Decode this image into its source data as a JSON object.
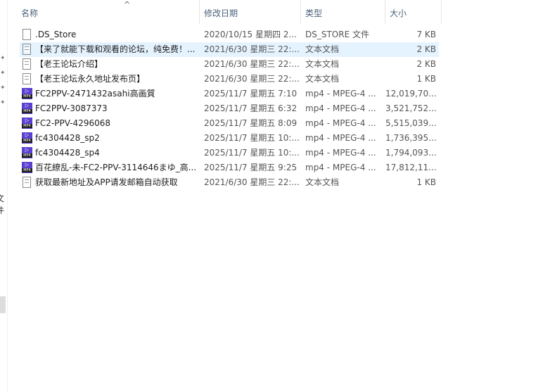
{
  "columns": {
    "name": "名称",
    "date": "修改日期",
    "type": "类型",
    "size": "大小"
  },
  "left_fragment": "文件",
  "files": [
    {
      "icon": "file-icon",
      "name": ".DS_Store",
      "date": "2020/10/15 星期四 2...",
      "type": "DS_STORE 文件",
      "size": "7 KB"
    },
    {
      "icon": "text-file-icon",
      "name": "【来了就能下载和观看的论坛，纯免费！...",
      "date": "2021/6/30 星期三 22:...",
      "type": "文本文档",
      "size": "2 KB",
      "selected": true
    },
    {
      "icon": "text-file-icon",
      "name": "【老王论坛介绍】",
      "date": "2021/6/30 星期三 22:...",
      "type": "文本文档",
      "size": "2 KB"
    },
    {
      "icon": "text-file-icon",
      "name": "【老王论坛永久地址发布页】",
      "date": "2021/6/30 星期三 22:...",
      "type": "文本文档",
      "size": "1 KB"
    },
    {
      "icon": "mp4-icon",
      "name": "FC2PPV-2471432asahi高画質",
      "date": "2025/11/7 星期五 7:10",
      "type": "mp4 - MPEG-4 ...",
      "size": "12,019,70..."
    },
    {
      "icon": "mp4-icon",
      "name": "FC2PPV-3087373",
      "date": "2025/11/7 星期五 6:32",
      "type": "mp4 - MPEG-4 ...",
      "size": "3,521,752..."
    },
    {
      "icon": "mp4-icon",
      "name": "FC2-PPV-4296068",
      "date": "2025/11/7 星期五 8:09",
      "type": "mp4 - MPEG-4 ...",
      "size": "5,515,039..."
    },
    {
      "icon": "mp4-icon",
      "name": "fc4304428_sp2",
      "date": "2025/11/7 星期五 10:...",
      "type": "mp4 - MPEG-4 ...",
      "size": "1,736,395..."
    },
    {
      "icon": "mp4-icon",
      "name": "fc4304428_sp4",
      "date": "2025/11/7 星期五 10:...",
      "type": "mp4 - MPEG-4 ...",
      "size": "1,794,093..."
    },
    {
      "icon": "mp4-icon",
      "name": "百花繚乱-未-FC2-PPV-3114646まゆ_高...",
      "date": "2025/11/7 星期五 9:25",
      "type": "mp4 - MPEG-4 ...",
      "size": "17,812,11..."
    },
    {
      "icon": "text-file-icon",
      "name": "获取最新地址及APP请发邮箱自动获取",
      "date": "2021/6/30 星期三 22:...",
      "type": "文本文档",
      "size": "1 KB"
    }
  ]
}
